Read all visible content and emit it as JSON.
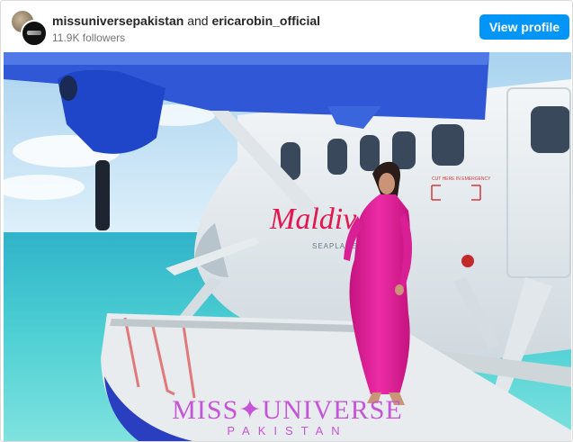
{
  "header": {
    "account_primary": "missuniversepakistan",
    "connector": "and",
    "account_secondary": "ericarobin_official",
    "followers": "11.9K followers",
    "view_profile_label": "View profile"
  },
  "photo": {
    "plane_livery": "Maldiv",
    "plane_sublabel": "SEAPLANE",
    "exit_label": "CUT HERE IN EMERGENCY",
    "watermark_main": "MISS✦UNIVERSE",
    "watermark_sub": "PAKISTAN"
  },
  "colors": {
    "button": "#0095f6",
    "dress": "#e0219a",
    "water": "#35c2d0",
    "wing": "#2f57d6",
    "watermark": "#c455d8"
  }
}
